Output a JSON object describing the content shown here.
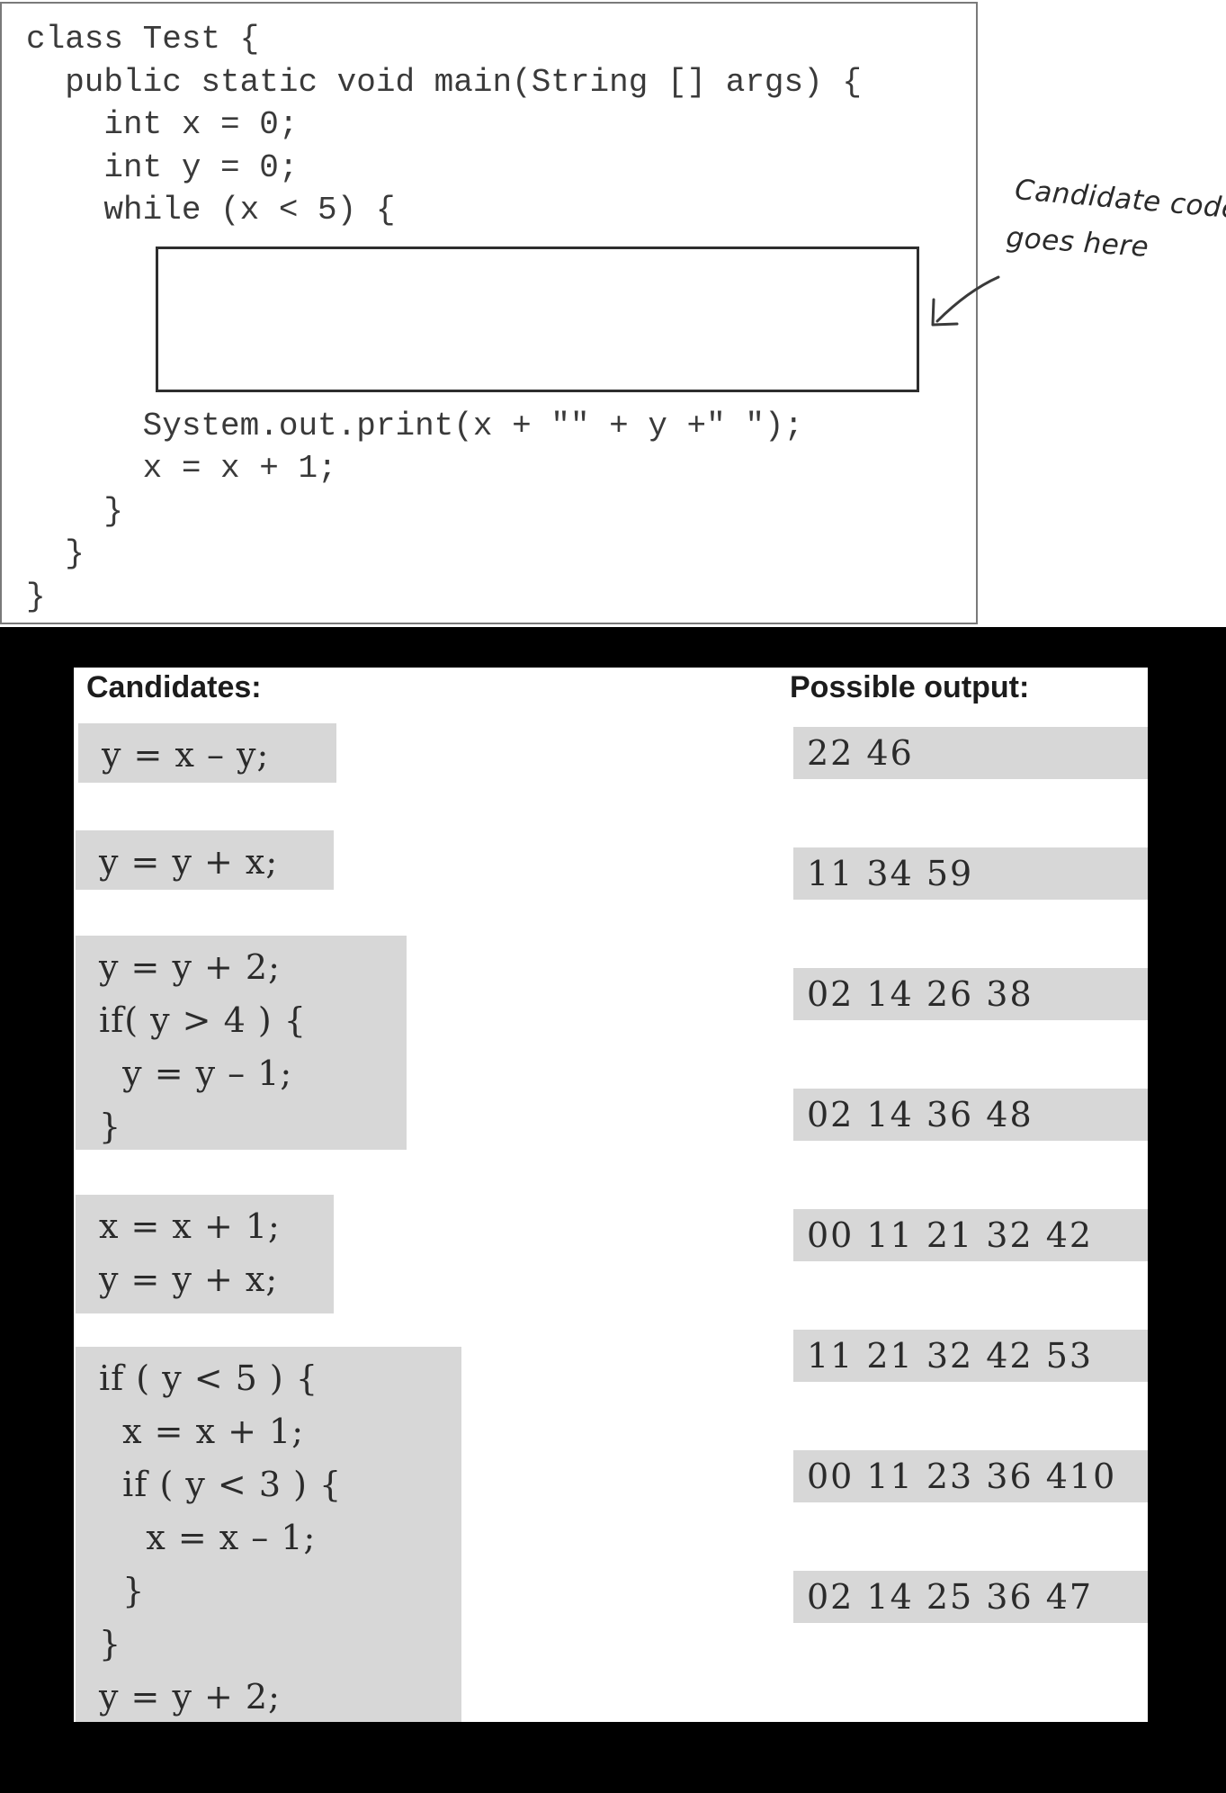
{
  "code": {
    "lines": [
      "class Test {",
      "  public static void main(String [] args) {",
      "    int x = 0;",
      "    int y = 0;",
      "    while (x < 5) {",
      "      System.out.print(x + \"\" + y +\" \");",
      "      x = x + 1;",
      "    }",
      "  }",
      "}"
    ]
  },
  "annotation": {
    "line1": "Candidate code",
    "line2": "goes here"
  },
  "candidates_heading": "Candidates:",
  "output_heading": "Possible output:",
  "candidates": [
    {
      "lines": [
        "y = x – y;"
      ]
    },
    {
      "lines": [
        "y = y + x;"
      ]
    },
    {
      "lines": [
        "y = y + 2;",
        "if( y > 4 ) {",
        "  y = y – 1;",
        "}"
      ]
    },
    {
      "lines": [
        "x = x + 1;",
        "y = y + x;"
      ]
    },
    {
      "lines": [
        "if ( y < 5 ) {",
        "  x = x + 1;",
        "  if ( y < 3 ) {",
        "    x = x – 1;",
        "  }",
        "}",
        "y = y + 2;"
      ]
    }
  ],
  "outputs": [
    "22 46",
    "11 34 59",
    "02 14 26 38",
    "02 14 36 48",
    "00 11 21 32 42",
    "11 21 32 42 53",
    "00 11 23 36 410",
    "02 14 25 36 47"
  ],
  "colors": {
    "page_background": "#000000",
    "panel_background": "#ffffff",
    "snippet_background": "#d7d7d7",
    "code_text": "#3a3a3a"
  }
}
